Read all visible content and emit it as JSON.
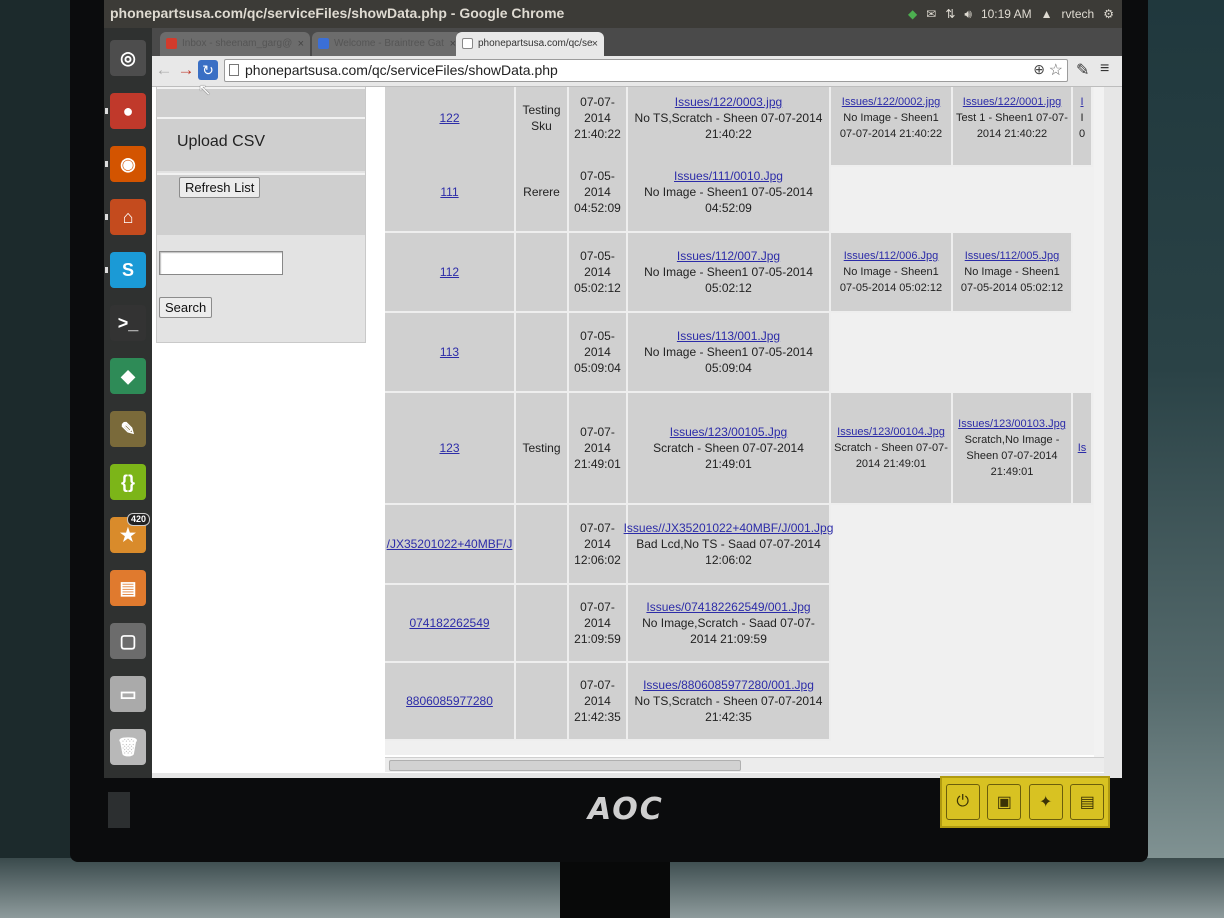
{
  "window_title": "phonepartsusa.com/qc/serviceFiles/showData.php - Google Chrome",
  "indicators": {
    "time": "10:19 AM",
    "user": "rvtech"
  },
  "tabs": [
    {
      "label": "Inbox - sheenam_garg@",
      "favicon_color": "#d23b2c"
    },
    {
      "label": "Welcome - Braintree Gat",
      "favicon_color": "#3b6fd6"
    },
    {
      "label": "phonepartsusa.com/qc/se",
      "favicon_color": "#ffffff"
    }
  ],
  "toolbar": {
    "url": "phonepartsusa.com/qc/serviceFiles/showData.php"
  },
  "launcher": [
    {
      "icon": "ubuntu-dash-icon",
      "color": "#4d4d4d"
    },
    {
      "icon": "chrome-icon",
      "color": "#c0392b"
    },
    {
      "icon": "firefox-icon",
      "color": "#d35400"
    },
    {
      "icon": "files-home-icon",
      "color": "#c44b1e"
    },
    {
      "icon": "skype-icon",
      "color": "#1b9ad6"
    },
    {
      "icon": "terminal-icon",
      "color": "#333333"
    },
    {
      "icon": "cube-app-icon",
      "color": "#2e8b57"
    },
    {
      "icon": "gimp-icon",
      "color": "#7a6a3a"
    },
    {
      "icon": "code-editor-icon",
      "color": "#7cb518"
    },
    {
      "icon": "updates-icon",
      "color": "#d98b2b",
      "badge": "420"
    },
    {
      "icon": "impress-icon",
      "color": "#e07a2e"
    },
    {
      "icon": "workspace-icon",
      "color": "#6c6c6c"
    },
    {
      "icon": "drive-icon",
      "color": "#aaaaaa"
    },
    {
      "icon": "trash-icon",
      "color": "#b8b8b8"
    }
  ],
  "sidebar": {
    "upload_label": "Upload CSV",
    "refresh_label": "Refresh List",
    "search_value": "",
    "search_label": "Search"
  },
  "rows": [
    {
      "id": "122",
      "sku": "Testing Sku",
      "date": [
        "07-07-",
        "2014",
        "21:40:22"
      ],
      "issues": [
        {
          "link": "Issues/122/0003.jpg",
          "text": "No TS,Scratch - Sheen 07-07-2014 21:40:22"
        },
        {
          "link": "Issues/122/0002.jpg",
          "text": "No Image - Sheen1 07-07-2014 21:40:22"
        },
        {
          "link": "Issues/122/0001.jpg",
          "text": "Test 1 - Sheen1 07-07-2014 21:40:22"
        },
        {
          "link": "I",
          "text": "I 0"
        }
      ]
    },
    {
      "id": "111",
      "sku": "Rerere",
      "date": [
        "07-05-",
        "2014",
        "04:52:09"
      ],
      "issues": [
        {
          "link": "Issues/111/0010.Jpg",
          "text": "No Image - Sheen1 07-05-2014 04:52:09"
        }
      ]
    },
    {
      "id": "112",
      "sku": "",
      "date": [
        "07-05-",
        "2014",
        "05:02:12"
      ],
      "issues": [
        {
          "link": "Issues/112/007.Jpg",
          "text": "No Image - Sheen1 07-05-2014 05:02:12"
        },
        {
          "link": "Issues/112/006.Jpg",
          "text": "No Image - Sheen1 07-05-2014 05:02:12"
        },
        {
          "link": "Issues/112/005.Jpg",
          "text": "No Image - Sheen1 07-05-2014 05:02:12"
        }
      ]
    },
    {
      "id": "113",
      "sku": "",
      "date": [
        "07-05-",
        "2014",
        "05:09:04"
      ],
      "issues": [
        {
          "link": "Issues/113/001.Jpg",
          "text": "No Image - Sheen1 07-05-2014 05:09:04"
        }
      ]
    },
    {
      "id": "123",
      "sku": "Testing",
      "date": [
        "07-07-",
        "2014",
        "21:49:01"
      ],
      "issues": [
        {
          "link": "Issues/123/00105.Jpg",
          "text": "Scratch - Sheen 07-07-2014 21:49:01"
        },
        {
          "link": "Issues/123/00104.Jpg",
          "text": "Scratch - Sheen 07-07-2014 21:49:01"
        },
        {
          "link": "Issues/123/00103.Jpg",
          "text": "Scratch,No Image - Sheen 07-07-2014 21:49:01"
        },
        {
          "link": "Is",
          "text": ""
        }
      ]
    },
    {
      "id": "/JX35201022+40MBF/J",
      "sku": "",
      "date": [
        "07-07-",
        "2014",
        "12:06:02"
      ],
      "issues": [
        {
          "link": "Issues//JX35201022+40MBF/J/001.Jpg",
          "text": "Bad Lcd,No TS - Saad 07-07-2014 12:06:02"
        }
      ]
    },
    {
      "id": "074182262549",
      "sku": "",
      "date": [
        "07-07-",
        "2014",
        "21:09:59"
      ],
      "issues": [
        {
          "link": "Issues/074182262549/001.Jpg",
          "text": "No Image,Scratch - Saad 07-07-2014 21:09:59"
        }
      ]
    },
    {
      "id": "8806085977280",
      "sku": "",
      "date": [
        "07-07-",
        "2014",
        "21:42:35"
      ],
      "issues": [
        {
          "link": "Issues/8806085977280/001.Jpg",
          "text": "No TS,Scratch - Sheen 07-07-2014 21:42:35"
        }
      ]
    }
  ],
  "monitor": {
    "brand": "AOC"
  }
}
